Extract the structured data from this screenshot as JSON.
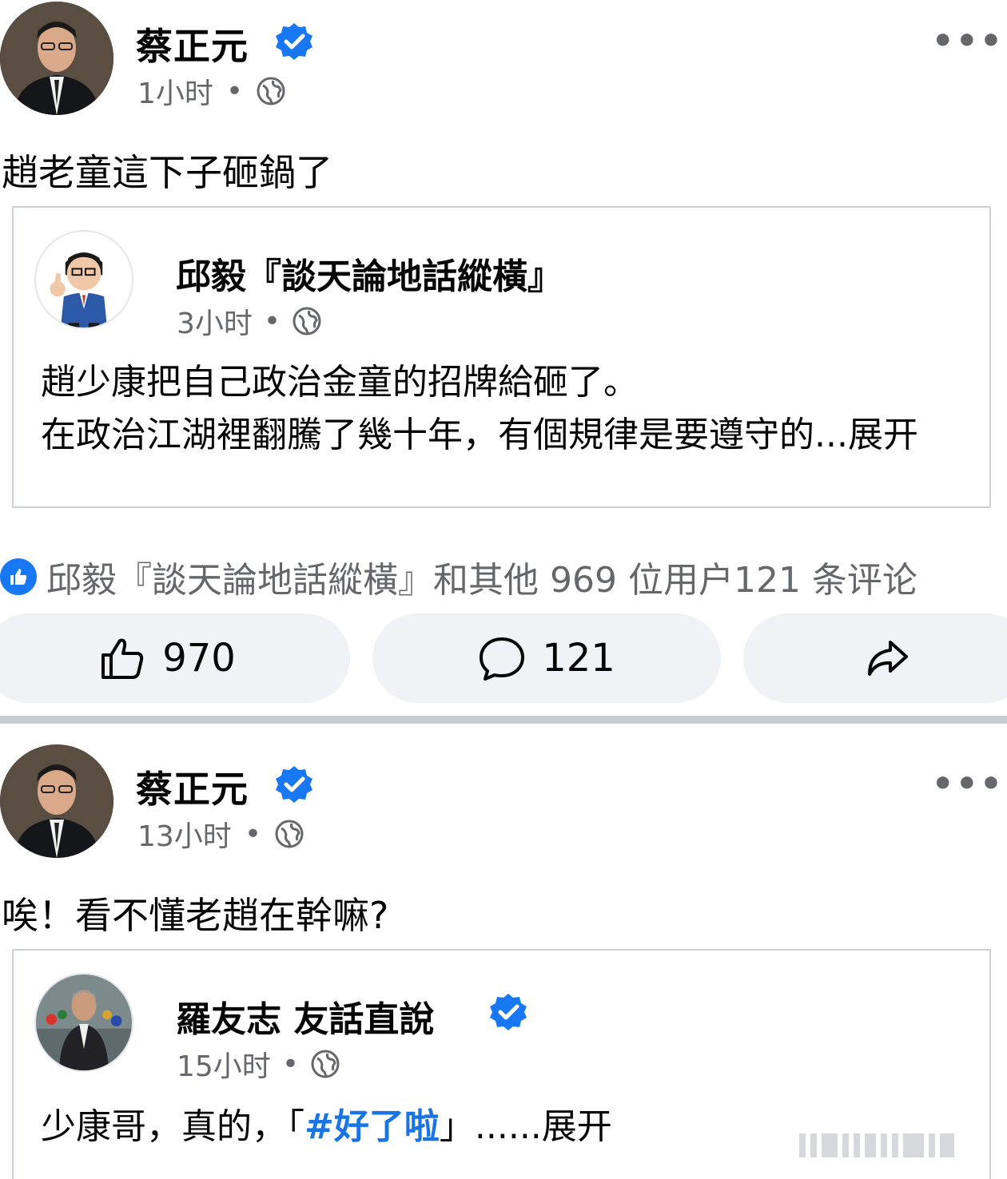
{
  "post1": {
    "author": "蔡正元",
    "time": "1小时",
    "dot": "•",
    "more": "•••",
    "text": "趙老童這下子砸鍋了",
    "shared": {
      "author": "邱毅『談天論地話縱橫』",
      "time": "3小时",
      "dot": "•",
      "line1": "趙少康把自己政治金童的招牌給砸了。",
      "line2": "在政治江湖裡翻騰了幾十年，有個規律是要遵守的...展开"
    },
    "reactions_summary": "邱毅『談天論地話縱橫』和其他 969 位用户121 条评论",
    "like_count": "970",
    "comment_count": "121"
  },
  "post2": {
    "author": "蔡正元",
    "time": "13小时",
    "dot": "•",
    "more": "•••",
    "text": "唉！看不懂老趙在幹嘛?",
    "shared": {
      "author": "羅友志 友話直說",
      "time": "15小时",
      "dot": "•",
      "text_prefix": "少康哥，真的，「",
      "hashtag": "#好了啦",
      "text_suffix": "」......展开",
      "avatar_caption": "羅友志"
    }
  },
  "colors": {
    "verified_blue": "#1877f2",
    "secondary_text": "#65676b",
    "button_bg": "#f0f2f5",
    "hashtag": "#1b74e4"
  },
  "icons": [
    "verified-badge-icon",
    "globe-icon",
    "more-icon",
    "like-icon",
    "comment-icon",
    "share-icon"
  ]
}
